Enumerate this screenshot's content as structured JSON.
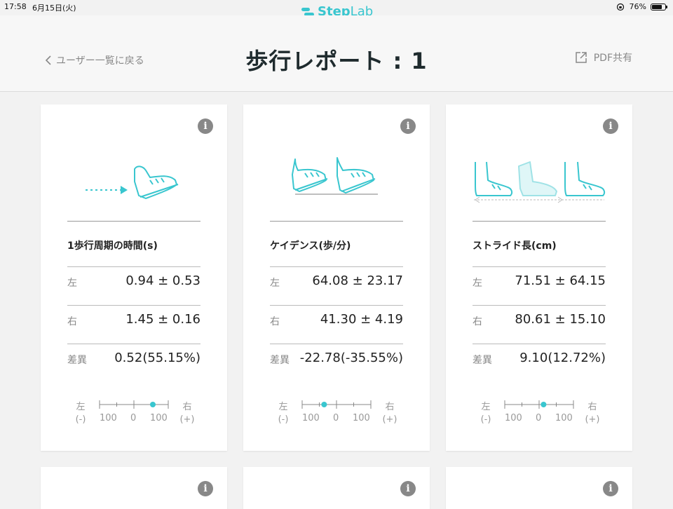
{
  "status": {
    "time": "17:58",
    "date": "6月15日(火)",
    "battery": "76%",
    "battery_level": 0.76
  },
  "app": {
    "logo_bold": "Step",
    "logo_light": "Lab"
  },
  "header": {
    "back_label": "ユーザー一覧に戻る",
    "title": "歩行レポート : 1",
    "pdf_label": "PDF共有"
  },
  "labels": {
    "left": "左",
    "right": "右",
    "diff": "差異",
    "minus": "(-)",
    "plus": "(+)",
    "tick_left": "100",
    "tick_mid": "0",
    "tick_right": "100"
  },
  "cards": [
    {
      "metric": "1歩行周期の時間(s)",
      "left": "0.94 ± 0.53",
      "right": "1.45 ± 0.16",
      "diff": "0.52(55.15%)",
      "indicator": 0.55,
      "illustration": "shoe-arrow-icon"
    },
    {
      "metric": "ケイデンス(歩/分)",
      "left": "64.08 ± 23.17",
      "right": "41.30 ± 4.19",
      "diff": "-22.78(-35.55%)",
      "indicator": -0.36,
      "illustration": "two-shoes-icon"
    },
    {
      "metric": "ストライド長(cm)",
      "left": "71.51 ± 64.15",
      "right": "80.61 ± 15.10",
      "diff": "9.10(12.72%)",
      "indicator": 0.13,
      "illustration": "stride-shoes-icon"
    }
  ],
  "colors": {
    "accent": "#39c6cf",
    "muted": "#888888"
  }
}
